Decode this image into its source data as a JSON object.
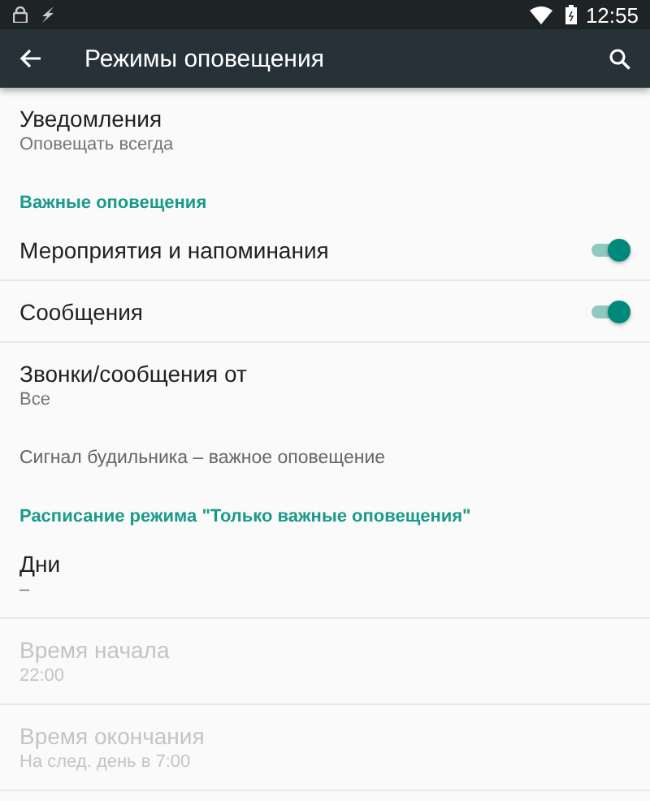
{
  "status_bar": {
    "time": "12:55"
  },
  "app_bar": {
    "title": "Режимы оповещения"
  },
  "items": [
    {
      "kind": "two_line",
      "title": "Уведомления",
      "subtitle": "Оповещать всегда",
      "disabled": false,
      "divider": false
    },
    {
      "kind": "header",
      "title": "Важные оповещения"
    },
    {
      "kind": "switch",
      "title": "Мероприятия и напоминания",
      "on": true
    },
    {
      "kind": "switch",
      "title": "Сообщения",
      "on": true
    },
    {
      "kind": "two_line",
      "title": "Звонки/сообщения от",
      "subtitle": "Все",
      "disabled": false,
      "divider": false
    },
    {
      "kind": "note",
      "title": "Сигнал будильника – важное оповещение"
    },
    {
      "kind": "header",
      "title": "Расписание режима \"Только важные оповещения\""
    },
    {
      "kind": "two_line",
      "title": "Дни",
      "subtitle": "–",
      "disabled": false,
      "divider": true
    },
    {
      "kind": "two_line",
      "title": "Время начала",
      "subtitle": "22:00",
      "disabled": true,
      "divider": true
    },
    {
      "kind": "two_line",
      "title": "Время окончания",
      "subtitle": "На след. день в 7:00",
      "disabled": true,
      "divider": true
    }
  ]
}
